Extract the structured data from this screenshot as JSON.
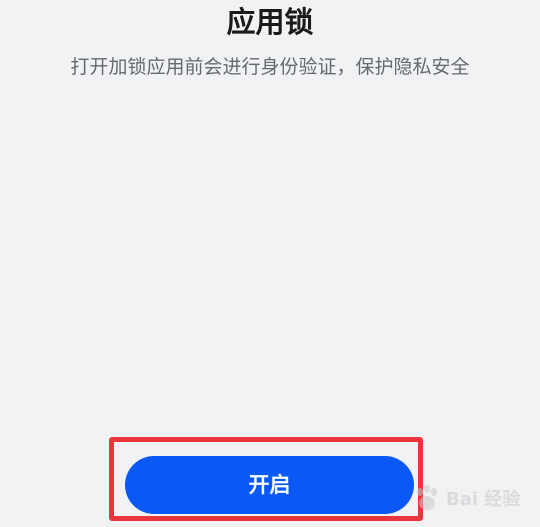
{
  "page": {
    "title": "应用锁",
    "subtitle": "打开加锁应用前会进行身份验证，保护隐私安全"
  },
  "action": {
    "enable_label": "开启"
  },
  "colors": {
    "background": "#f1f2f4",
    "primary": "#0a59f7",
    "highlight": "#e8363c"
  },
  "watermark": {
    "text": "Bai 经验"
  }
}
